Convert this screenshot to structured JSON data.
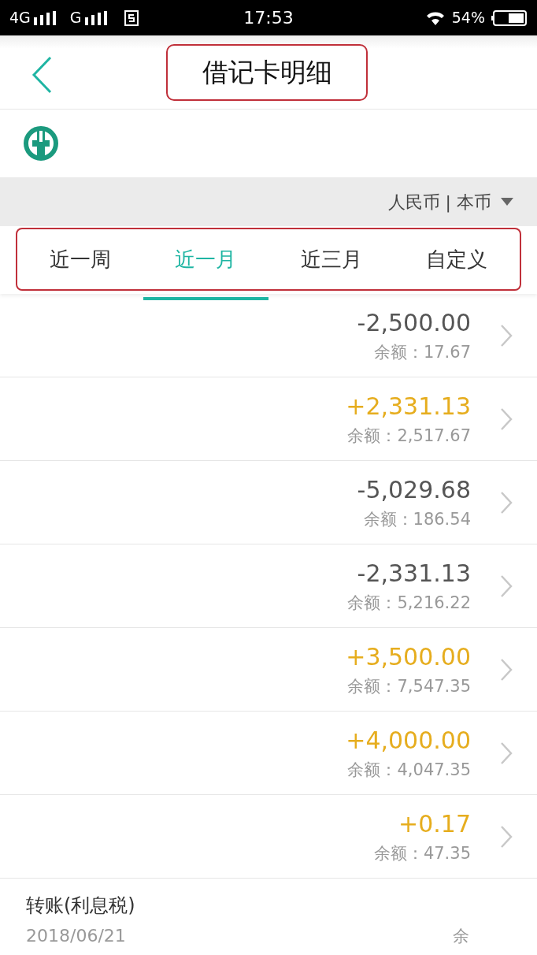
{
  "status_bar": {
    "network_1": "4G",
    "network_2": "G",
    "time": "17:53",
    "battery": "54%"
  },
  "header": {
    "title": "借记卡明细"
  },
  "currency": {
    "label": "人民币 | 本币"
  },
  "tabs": [
    {
      "label": "近一周",
      "selected": false
    },
    {
      "label": "近一月",
      "selected": true
    },
    {
      "label": "近三月",
      "selected": false
    },
    {
      "label": "自定义",
      "selected": false
    }
  ],
  "transactions": [
    {
      "kind": "expense",
      "amount": "-2,500.00",
      "balance": "余额：17.67"
    },
    {
      "kind": "income",
      "amount": "+2,331.13",
      "balance": "余额：2,517.67"
    },
    {
      "kind": "expense",
      "amount": "-5,029.68",
      "balance": "余额：186.54"
    },
    {
      "kind": "expense",
      "amount": "-2,331.13",
      "balance": "余额：5,216.22"
    },
    {
      "kind": "income",
      "amount": "+3,500.00",
      "balance": "余额：7,547.35"
    },
    {
      "kind": "income",
      "amount": "+4,000.00",
      "balance": "余额：4,047.35"
    },
    {
      "kind": "income",
      "amount": "+0.17",
      "balance": "余额：47.35"
    },
    {
      "kind": "detail",
      "title": "转账(利息税)",
      "date": "2018/06/21",
      "balance": "余"
    }
  ]
}
